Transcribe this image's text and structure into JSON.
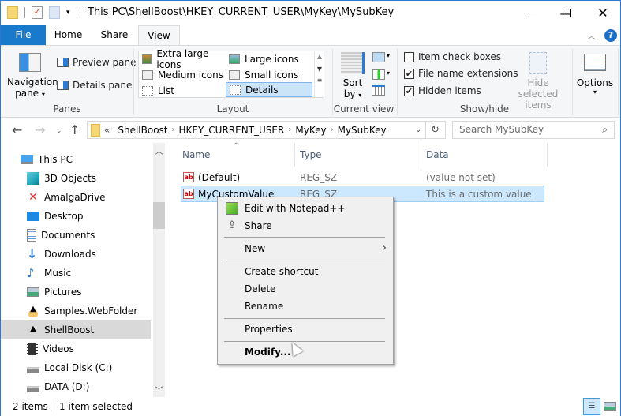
{
  "window": {
    "title": "This PC\\ShellBoost\\HKEY_CURRENT_USER\\MyKey\\MySubKey",
    "controls": {
      "minimize": "minimize-icon",
      "maximize": "maximize-icon",
      "close": "close-icon"
    },
    "accent": "#1979ca"
  },
  "quick_access": [
    "folder-icon",
    "properties-icon",
    "new-folder-icon",
    "customize-dropdown-icon"
  ],
  "tabs": [
    {
      "label": "File",
      "active": false
    },
    {
      "label": "Home",
      "active": false
    },
    {
      "label": "Share",
      "active": false
    },
    {
      "label": "View",
      "active": true
    }
  ],
  "ribbon": {
    "panes": {
      "label": "Panes",
      "navigation_pane": "Navigation",
      "navigation_pane_line2": "pane",
      "preview_pane": "Preview pane",
      "details_pane": "Details pane"
    },
    "layout": {
      "label": "Layout",
      "items": [
        {
          "label": "Extra large icons",
          "selected": false
        },
        {
          "label": "Large icons",
          "selected": false
        },
        {
          "label": "Medium icons",
          "selected": false
        },
        {
          "label": "Small icons",
          "selected": false
        },
        {
          "label": "List",
          "selected": false
        },
        {
          "label": "Details",
          "selected": true
        }
      ]
    },
    "current_view": {
      "label": "Current view",
      "sort_by": "Sort",
      "sort_by_line2": "by"
    },
    "show_hide": {
      "label": "Show/hide",
      "checkboxes": [
        {
          "label": "Item check boxes",
          "checked": false
        },
        {
          "label": "File name extensions",
          "checked": true
        },
        {
          "label": "Hidden items",
          "checked": true
        }
      ],
      "hide_selected": "Hide selected",
      "hide_selected_line2": "items"
    },
    "options": {
      "label": "Options"
    }
  },
  "navigation": {
    "breadcrumb": [
      "ShellBoost",
      "HKEY_CURRENT_USER",
      "MyKey",
      "MySubKey"
    ],
    "overflow": "«",
    "search_placeholder": "Search MySubKey"
  },
  "sidebar": {
    "items": [
      {
        "label": "This PC",
        "icon": "computer-icon",
        "selected": false
      },
      {
        "label": "3D Objects",
        "icon": "3d-objects-icon",
        "selected": false
      },
      {
        "label": "AmalgaDrive",
        "icon": "amalgadrive-icon",
        "selected": false
      },
      {
        "label": "Desktop",
        "icon": "desktop-icon",
        "selected": false
      },
      {
        "label": "Documents",
        "icon": "documents-icon",
        "selected": false
      },
      {
        "label": "Downloads",
        "icon": "downloads-icon",
        "selected": false
      },
      {
        "label": "Music",
        "icon": "music-icon",
        "selected": false
      },
      {
        "label": "Pictures",
        "icon": "pictures-icon",
        "selected": false
      },
      {
        "label": "Samples.WebFolder",
        "icon": "webfolder-icon",
        "selected": false
      },
      {
        "label": "ShellBoost",
        "icon": "shellboost-icon",
        "selected": true
      },
      {
        "label": "Videos",
        "icon": "videos-icon",
        "selected": false
      },
      {
        "label": "Local Disk (C:)",
        "icon": "local-disk-icon",
        "selected": false
      },
      {
        "label": "DATA (D:)",
        "icon": "drive-icon",
        "selected": false
      }
    ]
  },
  "file_list": {
    "columns": [
      "Name",
      "Type",
      "Data"
    ],
    "rows": [
      {
        "name": "(Default)",
        "type": "REG_SZ",
        "data": "(value not set)",
        "selected": false
      },
      {
        "name": "MyCustomValue",
        "type": "REG_SZ",
        "data": "This is a custom value",
        "selected": true
      }
    ]
  },
  "context_menu": {
    "items": [
      {
        "label": "Edit with Notepad++",
        "icon": "notepadpp-icon"
      },
      {
        "label": "Share",
        "icon": "share-icon"
      },
      {
        "label": "New",
        "submenu": true
      },
      {
        "label": "Create shortcut"
      },
      {
        "label": "Delete"
      },
      {
        "label": "Rename"
      },
      {
        "label": "Properties"
      },
      {
        "label": "Modify...",
        "bold": true
      }
    ]
  },
  "status_bar": {
    "item_count": "2 items",
    "selection": "1 item selected"
  }
}
